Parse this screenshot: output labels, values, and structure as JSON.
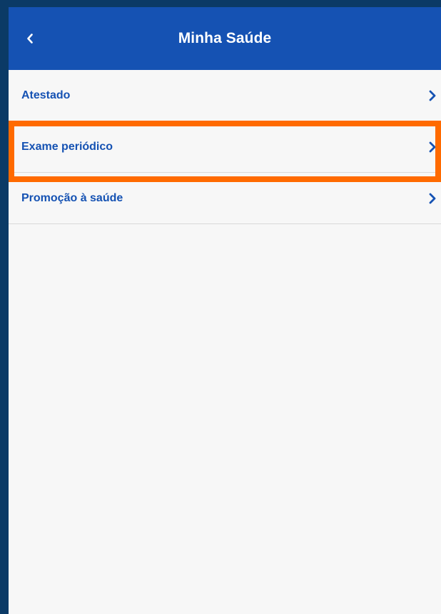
{
  "header": {
    "title": "Minha Saúde",
    "back_icon": "chevron-left-icon"
  },
  "menu": {
    "items": [
      {
        "label": "Atestado",
        "icon": "chevron-right-icon"
      },
      {
        "label": "Exame periódico",
        "icon": "chevron-right-icon",
        "highlighted": true
      },
      {
        "label": "Promoção à saúde",
        "icon": "chevron-right-icon"
      }
    ]
  },
  "colors": {
    "header_bg": "#1552b3",
    "accent_text": "#1552b3",
    "highlight": "#ff6a00",
    "page_bg": "#f7f7f7",
    "outer_bg": "#0b3a66"
  }
}
